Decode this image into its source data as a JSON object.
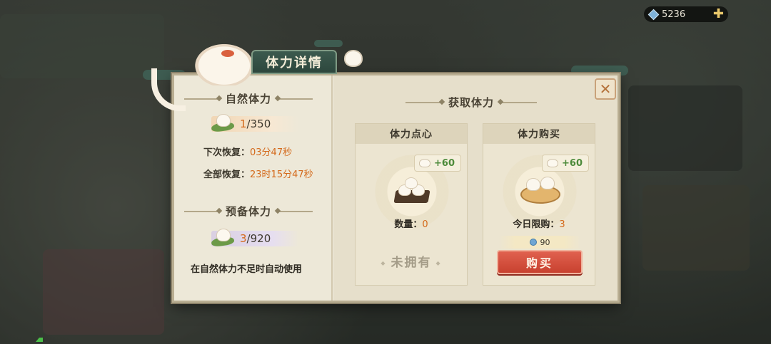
{
  "currency": {
    "icon": "gem-icon",
    "amount": "5236",
    "add_icon": "plus-icon"
  },
  "dialog": {
    "title": "体力详情",
    "close_icon": "close-icon",
    "natural": {
      "heading": "自然体力",
      "current": "1",
      "max": "/350",
      "next_recover_label": "下次恢复：",
      "next_recover_value": "03分47秒",
      "full_recover_label": "全部恢复：",
      "full_recover_value": "23时15分47秒"
    },
    "reserve": {
      "heading": "预备体力",
      "current": "3",
      "max": "/920",
      "note": "在自然体力不足时自动使用"
    },
    "obtain": {
      "heading": "获取体力",
      "snack": {
        "title": "体力点心",
        "gain": "+60",
        "qty_label": "数量：",
        "qty_value": "0",
        "status": "未拥有"
      },
      "purchase": {
        "title": "体力购买",
        "gain": "+60",
        "limit_label": "今日限购：",
        "limit_value": "3",
        "price": "90",
        "button": "购买"
      }
    }
  },
  "colors": {
    "accent": "#d46a1c",
    "buy_button": "#d0513e",
    "title_tab": "#35524a"
  }
}
